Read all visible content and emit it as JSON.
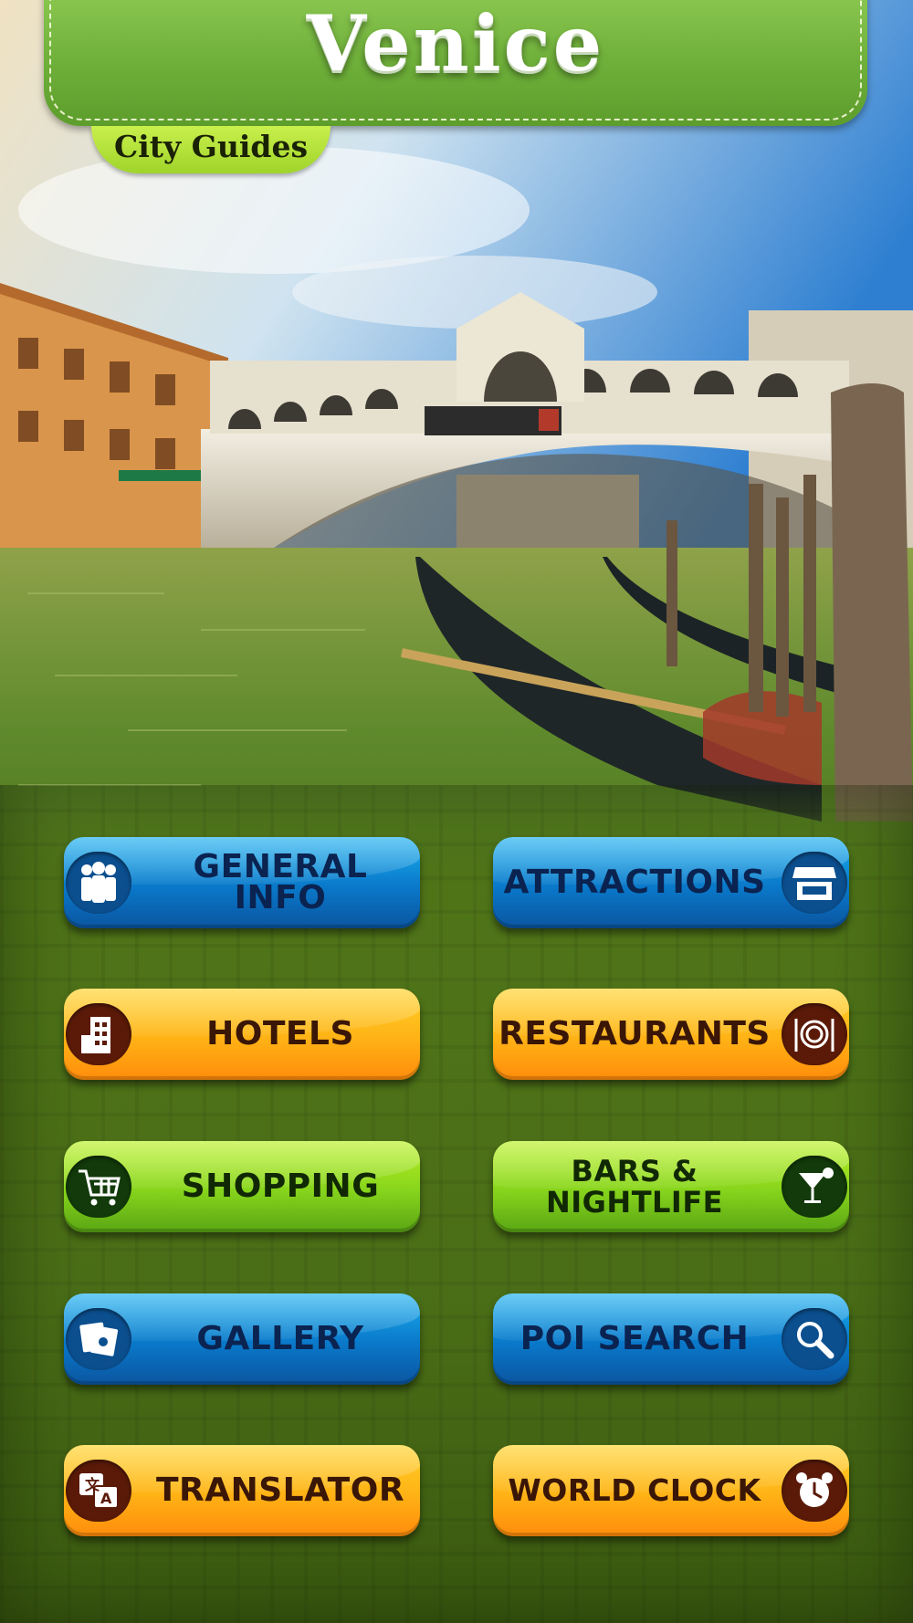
{
  "header": {
    "title": "Venice",
    "subtitle": "City Guides"
  },
  "menu": [
    {
      "label": "GENERAL INFO",
      "icon": "people-icon",
      "color": "blue"
    },
    {
      "label": "ATTRACTIONS",
      "icon": "storefront-icon",
      "color": "blue"
    },
    {
      "label": "HOTELS",
      "icon": "building-icon",
      "color": "orange"
    },
    {
      "label": "RESTAURANTS",
      "icon": "plate-cutlery-icon",
      "color": "orange"
    },
    {
      "label": "SHOPPING",
      "icon": "cart-icon",
      "color": "green"
    },
    {
      "label": "BARS &\nNIGHTLIFE",
      "icon": "cocktail-icon",
      "color": "green"
    },
    {
      "label": "GALLERY",
      "icon": "photos-icon",
      "color": "blue"
    },
    {
      "label": "POI SEARCH",
      "icon": "magnifier-icon",
      "color": "blue"
    },
    {
      "label": "TRANSLATOR",
      "icon": "translate-icon",
      "color": "orange"
    },
    {
      "label": "WORLD CLOCK",
      "icon": "alarm-clock-icon",
      "color": "orange"
    }
  ],
  "colors": {
    "banner": "#6fb03a",
    "blue_button": "#0a78c9",
    "orange_button": "#ffb215",
    "green_button": "#86d41c"
  }
}
